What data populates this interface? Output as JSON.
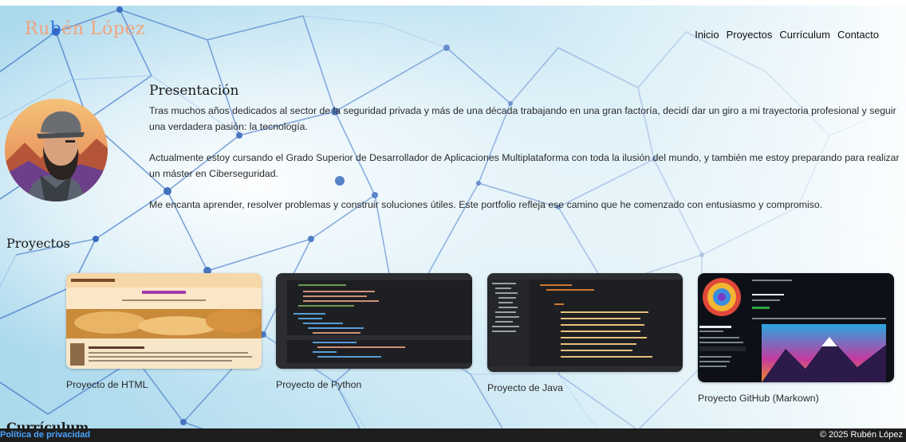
{
  "logo": {
    "part1": "Ru",
    "part2": "b",
    "part3": "én López"
  },
  "nav": [
    "Inicio",
    "Proyectos",
    "Currículum",
    "Contacto"
  ],
  "presentacion": {
    "title": "Presentación",
    "paragraphs": [
      "Tras muchos años dedicados al sector de la seguridad privada y más de una década trabajando en una gran factoría, decidí dar un giro a mi trayectoria profesional y seguir una verdadera pasión: la tecnología.",
      "Actualmente estoy cursando el Grado Superior de Desarrollador de Aplicaciones Multiplataforma con toda la ilusión del mundo, y también me estoy preparando para realizar un máster en Ciberseguridad.",
      "Me encanta aprender, resolver problemas y construir soluciones útiles. Este portfolio refleja ese camino que he comenzado con entusiasmo y compromiso."
    ]
  },
  "proyectos": {
    "title": "Proyectos",
    "items": [
      {
        "caption": "Proyecto de HTML"
      },
      {
        "caption": "Proyecto de Python"
      },
      {
        "caption": "Proyecto de Java"
      },
      {
        "caption": "Proyecto GitHub (Markown)"
      }
    ]
  },
  "curriculum_title": "Currículum",
  "footer": {
    "privacy": "Política de privacidad",
    "copyright": "© 2025 Rubén López"
  }
}
